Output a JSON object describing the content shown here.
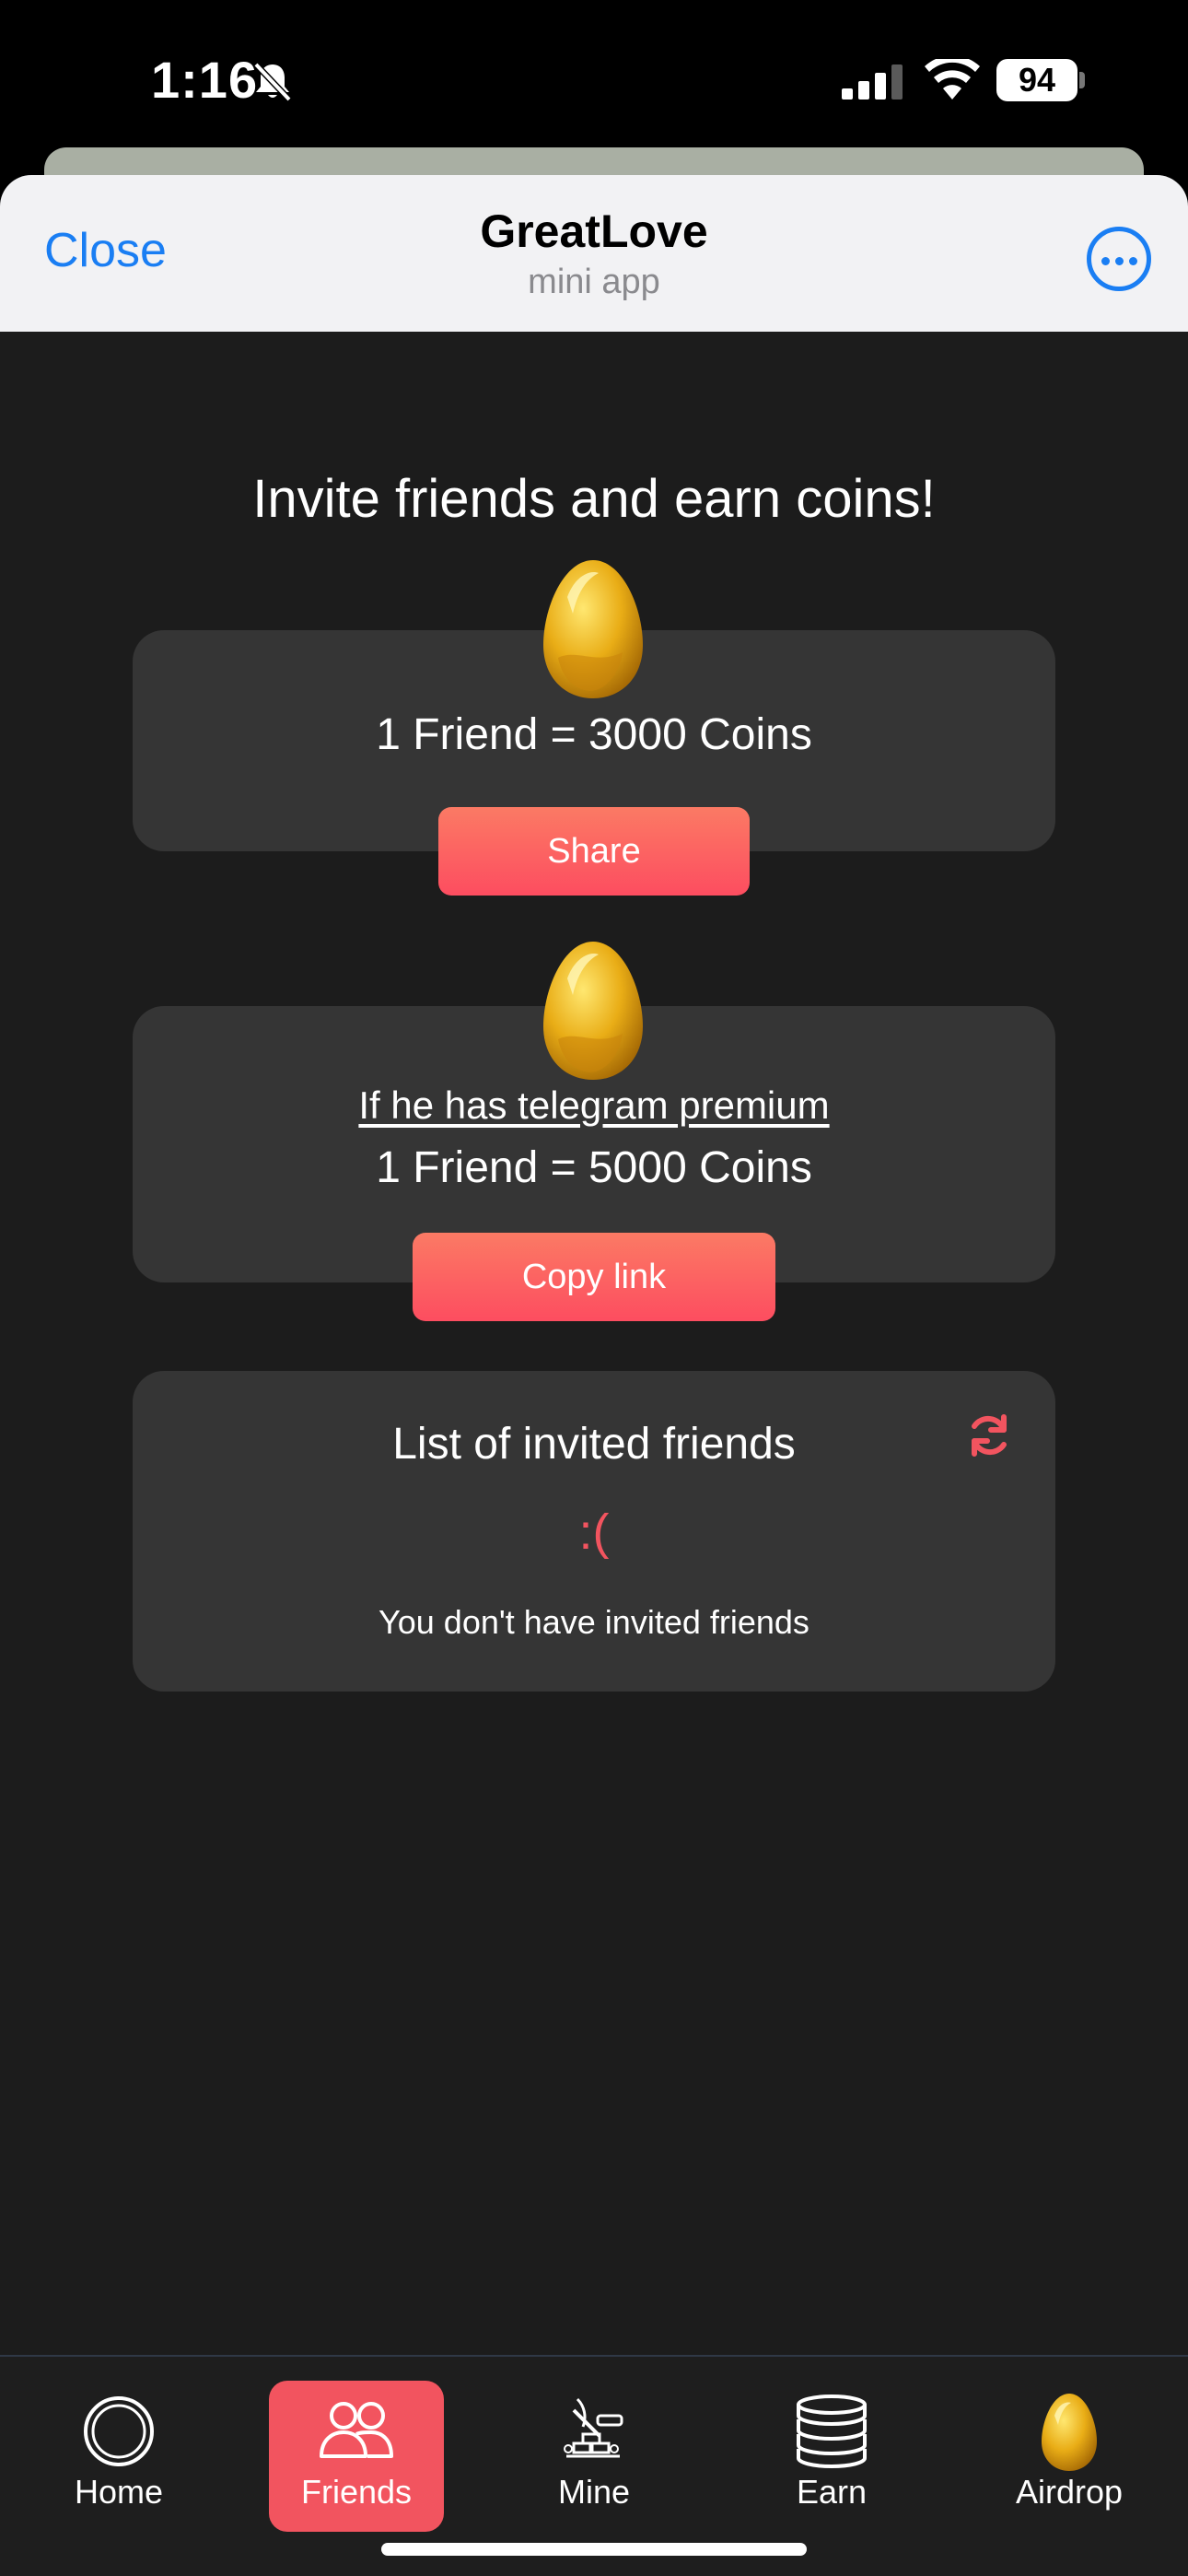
{
  "status_bar": {
    "time": "1:16",
    "battery": "94"
  },
  "header": {
    "close_label": "Close",
    "title": "GreatLove",
    "subtitle": "mini app"
  },
  "main": {
    "title": "Invite friends and earn coins!",
    "invite_card": {
      "reward_text": "1 Friend = 3000 Coins",
      "button_label": "Share"
    },
    "premium_card": {
      "condition_text": "If he has telegram premium",
      "reward_text": "1 Friend = 5000 Coins",
      "button_label": "Copy link"
    },
    "friends_list": {
      "title": "List of invited friends",
      "emoticon": ":(",
      "empty_text": "You don't have invited friends"
    }
  },
  "bottom_nav": {
    "items": [
      {
        "label": "Home",
        "icon": "home-circle-icon",
        "active": false
      },
      {
        "label": "Friends",
        "icon": "friends-icon",
        "active": true
      },
      {
        "label": "Mine",
        "icon": "mine-icon",
        "active": false
      },
      {
        "label": "Earn",
        "icon": "coins-stack-icon",
        "active": false
      },
      {
        "label": "Airdrop",
        "icon": "golden-egg-icon",
        "active": false
      }
    ]
  },
  "colors": {
    "accent": "#f2545f",
    "button_gradient_top": "#fb7a64",
    "button_gradient_bottom": "#fd4d60",
    "link_blue": "#1a7ef3",
    "background": "#1c1c1c",
    "card": "#353535"
  }
}
